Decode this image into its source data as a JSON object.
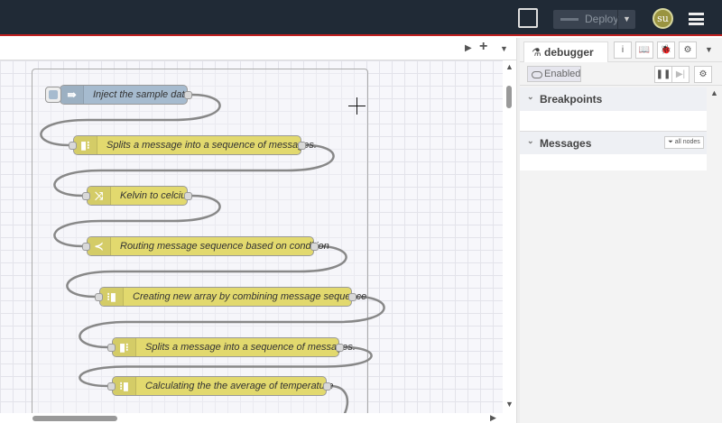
{
  "header": {
    "deploy_label": "Deploy",
    "avatar_initials": "su",
    "deploy_dropdown_icon": "caret-down-icon",
    "menu_icon": "hamburger-icon"
  },
  "workspace": {
    "tab_controls": [
      "caret-right-icon",
      "plus-icon",
      "caret-down-icon"
    ]
  },
  "colors": {
    "inject": "#a6bbcf",
    "function": "#e2d96e",
    "header": "#202a36"
  },
  "flow": {
    "nodes": [
      {
        "label": "Inject the sample data",
        "type": "inject",
        "icon": "arrow-right-icon",
        "glyph": "⇛"
      },
      {
        "label": "Splits a message into a sequence of messages.",
        "type": "split",
        "icon": "split-icon",
        "glyph": "▮⁝"
      },
      {
        "label": "Kelvin to celcius",
        "type": "change",
        "icon": "shuffle-icon",
        "glyph": "⤨"
      },
      {
        "label": "Routing message sequence based on condition",
        "type": "switch",
        "icon": "switch-icon",
        "glyph": "≺"
      },
      {
        "label": "Creating new array by combining message sequence",
        "type": "join",
        "icon": "join-icon",
        "glyph": "⁝▮"
      },
      {
        "label": "Splits a message into a sequence of messages.",
        "type": "split",
        "icon": "split-icon",
        "glyph": "▮⁝"
      },
      {
        "label": "Calculating the the average of temperature",
        "type": "join",
        "icon": "join-icon",
        "glyph": "⁝▮"
      }
    ]
  },
  "sidebar": {
    "tab_label": "debugger",
    "tab_buttons": [
      "i",
      "📖",
      "🐞",
      "⚙"
    ],
    "enabled_label": "Enabled",
    "sections": {
      "breakpoints": "Breakpoints",
      "messages": "Messages",
      "filter_label": "all nodes"
    }
  }
}
